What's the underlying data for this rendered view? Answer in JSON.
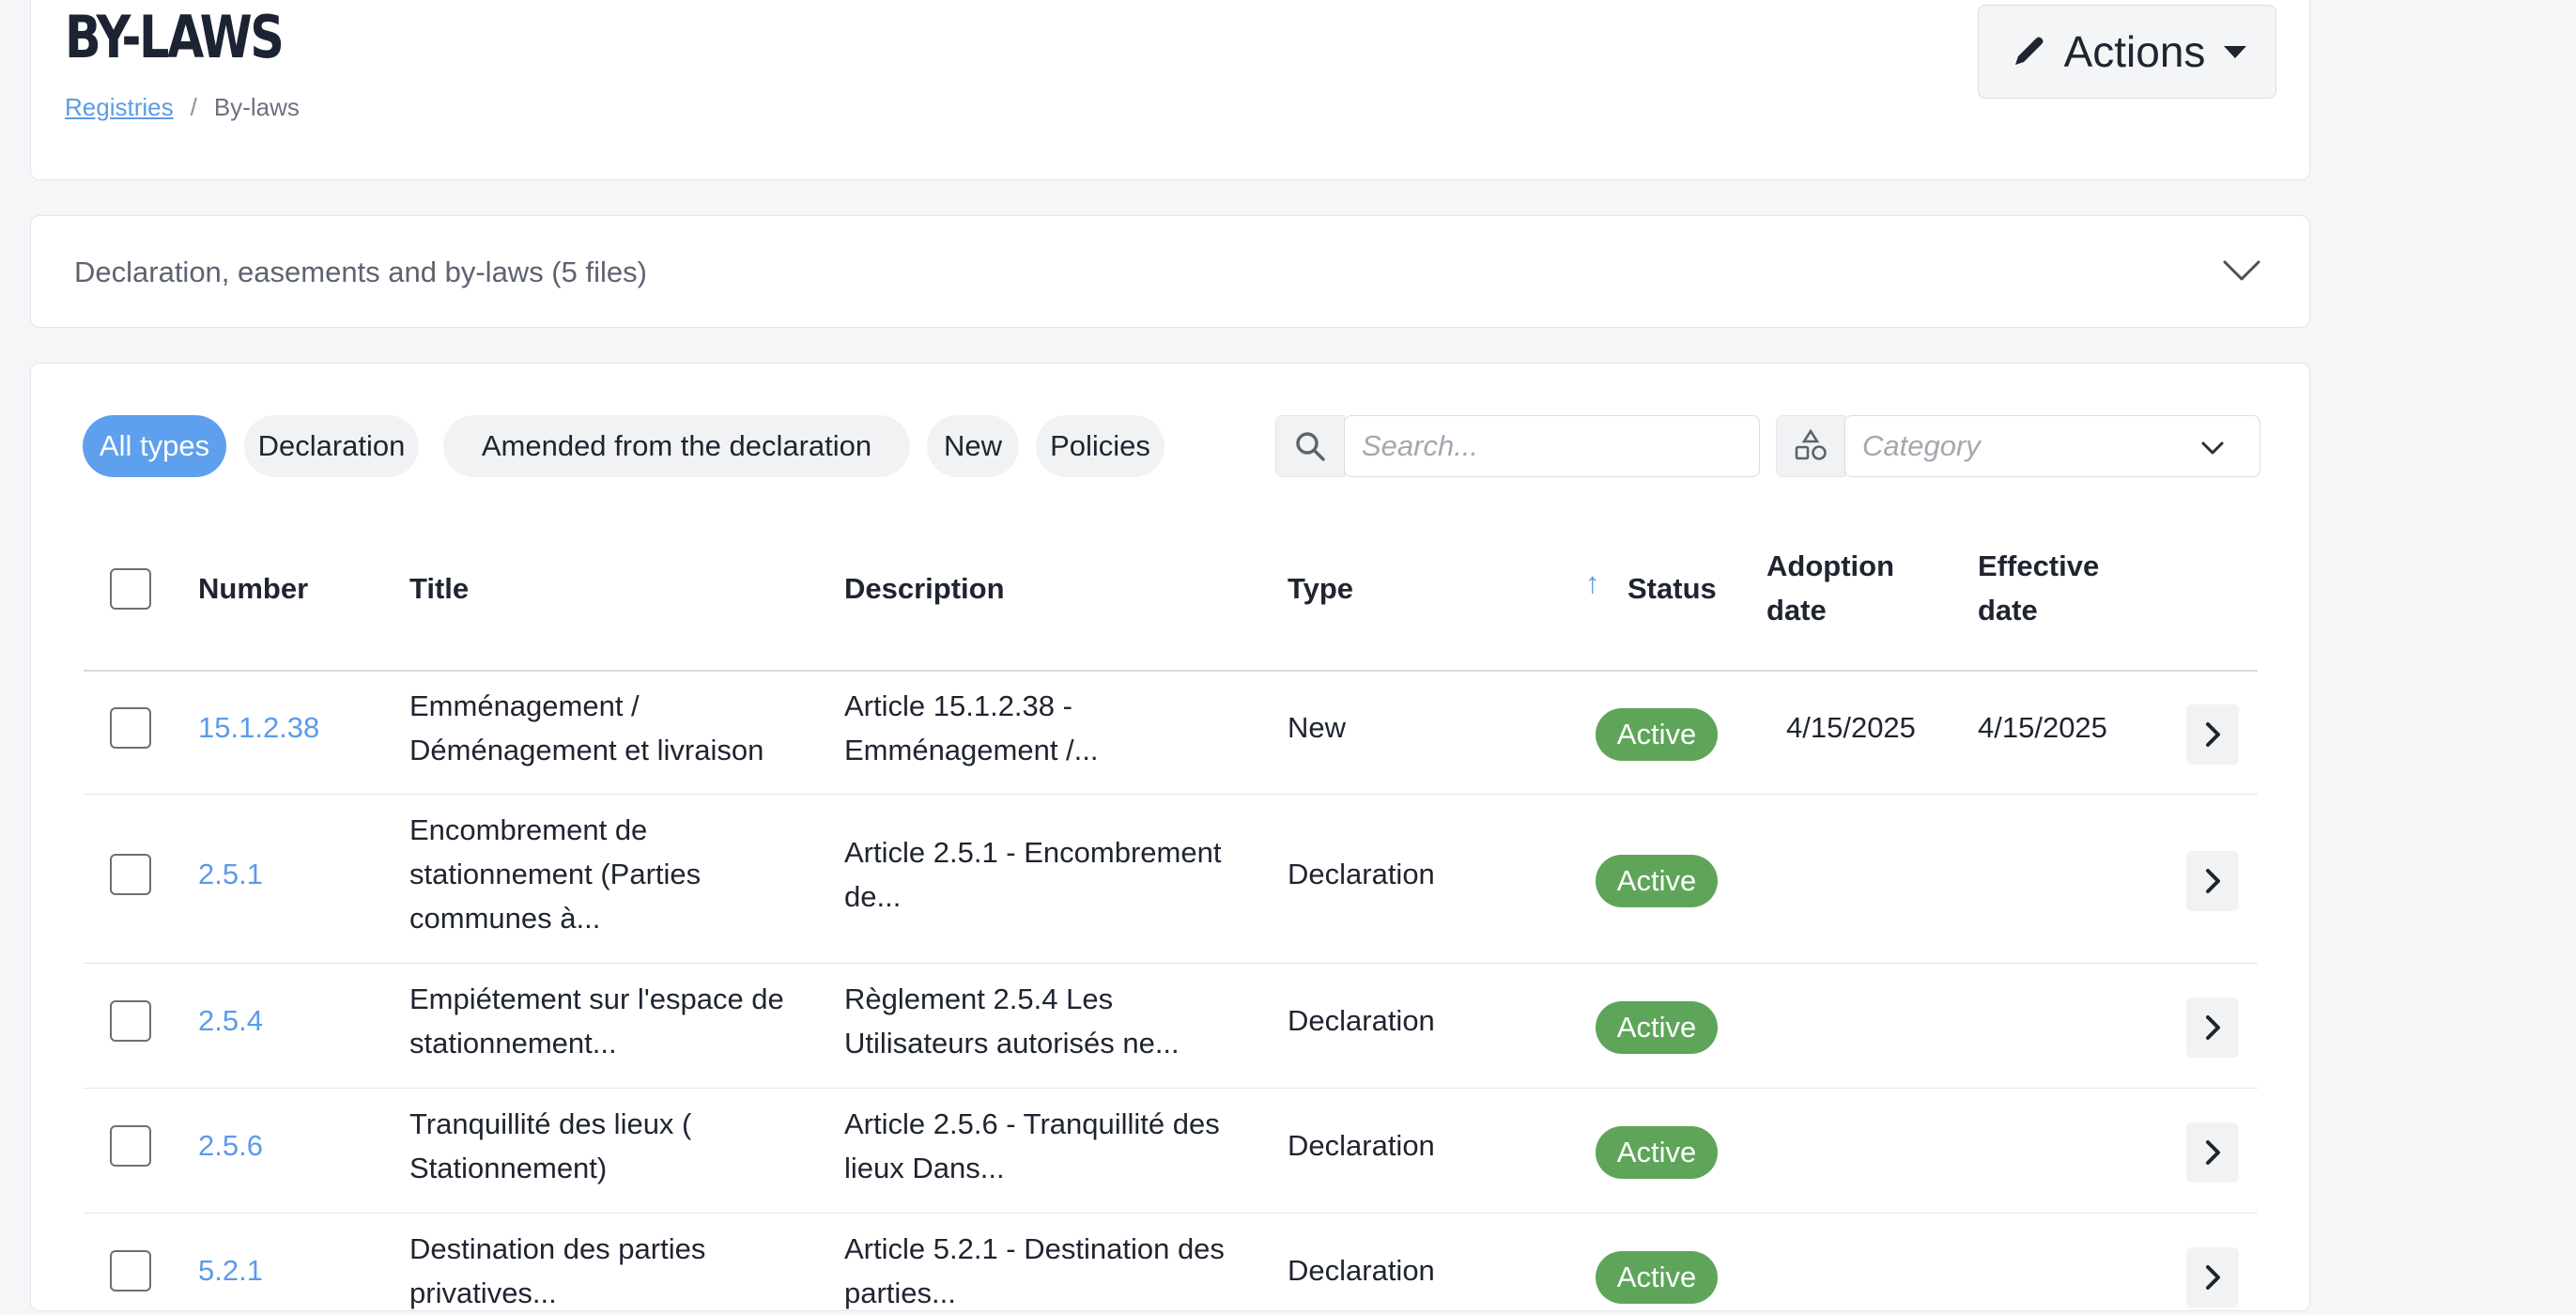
{
  "header": {
    "title": "BY-LAWS",
    "breadcrumb": {
      "parent": "Registries",
      "separator": "/",
      "current": "By-laws"
    },
    "actions_label": "Actions"
  },
  "accordion": {
    "label": "Declaration, easements and by-laws (5 files)"
  },
  "filters": {
    "types": [
      "All types",
      "Declaration",
      "Amended from the declaration",
      "New",
      "Policies"
    ],
    "active_type": "All types",
    "search_placeholder": "Search...",
    "category_placeholder": "Category"
  },
  "table": {
    "columns": {
      "number": "Number",
      "title": "Title",
      "description": "Description",
      "type": "Type",
      "status": "Status",
      "adoption_line1": "Adoption",
      "adoption_line2": "date",
      "effective_line1": "Effective",
      "effective_line2": "date"
    },
    "sort_indicator": "↑",
    "rows": [
      {
        "number": "15.1.2.38",
        "title": [
          "Emménagement /",
          "Déménagement et livraison"
        ],
        "description": [
          "Article 15.1.2.38  -",
          "Emménagement /..."
        ],
        "type": "New",
        "status": "Active",
        "adoption": "4/15/2025",
        "effective": "4/15/2025"
      },
      {
        "number": "2.5.1",
        "title": [
          "Encombrement de",
          "stationnement (Parties",
          "communes à..."
        ],
        "description": [
          "Article 2.5.1 - Encombrement",
          "de..."
        ],
        "type": "Declaration",
        "status": "Active",
        "adoption": "",
        "effective": ""
      },
      {
        "number": "2.5.4",
        "title": [
          "Empiétement sur l'espace de",
          "stationnement..."
        ],
        "description": [
          "Règlement 2.5.4 Les",
          "Utilisateurs autorisés ne..."
        ],
        "type": "Declaration",
        "status": "Active",
        "adoption": "",
        "effective": ""
      },
      {
        "number": "2.5.6",
        "title": [
          "Tranquillité des lieux (",
          "Stationnement)"
        ],
        "description": [
          "Article 2.5.6 - Tranquillité des",
          "lieux Dans..."
        ],
        "type": "Declaration",
        "status": "Active",
        "adoption": "",
        "effective": ""
      },
      {
        "number": "5.2.1",
        "title": [
          "Destination des parties",
          "privatives..."
        ],
        "description": [
          "Article 5.2.1 - Destination des",
          "parties..."
        ],
        "type": "Declaration",
        "status": "Active",
        "adoption": "",
        "effective": ""
      }
    ]
  },
  "colors": {
    "accent": "#5ea0ee",
    "link": "#5b9be8",
    "active_badge": "#5ea55a",
    "title": "#1c2433"
  },
  "icons": [
    "pencil-icon",
    "caret-down-icon",
    "chevron-down-icon",
    "search-icon",
    "category-shapes-icon",
    "chevron-right-icon",
    "sort-up-arrow-icon"
  ]
}
